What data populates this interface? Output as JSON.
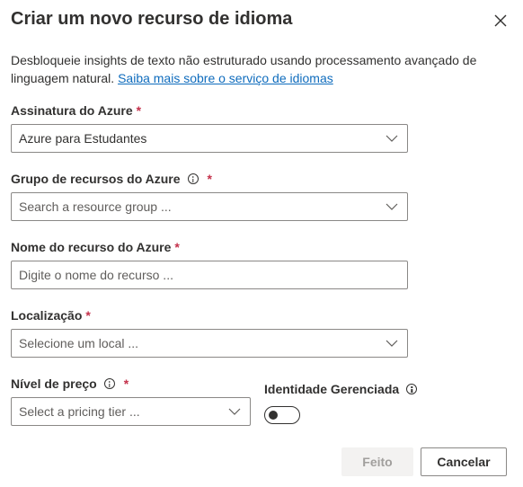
{
  "dialog": {
    "title": "Criar um novo recurso de idioma",
    "description": "Desbloqueie insights de texto não estruturado usando processamento avançado de linguagem natural.",
    "learn_more_link": "Saiba mais sobre o serviço de idiomas"
  },
  "fields": {
    "subscription": {
      "label": "Assinatura do Azure",
      "required": "*",
      "value": "Azure para Estudantes"
    },
    "resource_group": {
      "label": "Grupo de recursos do Azure",
      "required": "*",
      "placeholder": "Search a resource group ..."
    },
    "resource_name": {
      "label": "Nome do recurso do Azure",
      "required": "*",
      "placeholder": "Digite o nome do recurso ..."
    },
    "location": {
      "label": "Localização",
      "required": "*",
      "placeholder": "Selecione um local ..."
    },
    "pricing_tier": {
      "label": "Nível de preço",
      "required": "*",
      "placeholder": "Select a pricing tier ..."
    },
    "managed_identity": {
      "label": "Identidade Gerenciada",
      "state": "off"
    }
  },
  "buttons": {
    "done": "Feito",
    "cancel": "Cancelar"
  },
  "icons": {
    "close": "close-icon",
    "info": "info-icon",
    "dropdown": "chevron-down-icon"
  },
  "colors": {
    "link": "#0f6cbd",
    "required": "#c4314b",
    "border": "#8a8886",
    "disabled_bg": "#f3f2f1"
  }
}
